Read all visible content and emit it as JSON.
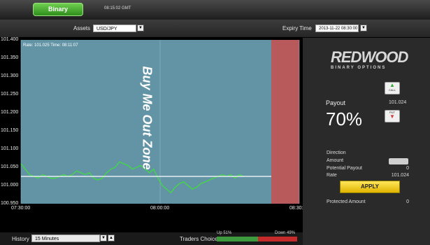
{
  "topbar": {
    "binary_label": "Binary",
    "time": "08:15:02 GMT"
  },
  "options": {
    "assets_label": "Assets",
    "asset_value": "USD/JPY",
    "expiry_label": "Expiry Time",
    "expiry_value": "2013-11-22 08:30:00"
  },
  "chart": {
    "rate_info": "Rate: 101.025 Time: 08:11:07",
    "zone_text": "Buy Me Out Zone",
    "y_ticks": [
      "101.400",
      "101.350",
      "101.300",
      "101.250",
      "101.200",
      "101.150",
      "101.100",
      "101.050",
      "101.000",
      "100.950"
    ],
    "x_ticks": [
      "07:30:00",
      "08:00:00",
      "08:30:00"
    ]
  },
  "chart_data": {
    "type": "line",
    "ylim": [
      100.95,
      101.4
    ],
    "x_range": [
      "07:30:00",
      "08:30:00"
    ],
    "current_rate": 101.025,
    "series": [
      {
        "values": [
          101.06,
          101.045,
          101.03,
          101.025,
          101.02,
          101.03,
          101.025,
          101.02,
          101.02,
          101.025,
          101.03,
          101.025,
          101.03,
          101.04,
          101.035,
          101.03,
          101.035,
          101.02,
          101.015,
          101.02,
          101.035,
          101.045,
          101.05,
          101.065,
          101.06,
          101.055,
          101.045,
          101.05,
          101.055,
          101.045,
          101.035,
          101.045,
          101.02,
          101.0,
          100.99,
          100.98,
          100.995,
          101.005,
          101.01,
          101.0,
          100.99,
          100.995,
          101.005,
          101.01,
          101.015,
          101.02,
          101.025,
          101.03,
          101.025,
          101.03,
          101.02,
          101.03,
          101.025
        ]
      }
    ]
  },
  "history": {
    "label": "History",
    "value": "15 Minutes"
  },
  "traders": {
    "label": "Traders Choice",
    "up": "Up 51%",
    "down": "Down 49%",
    "up_fraction": 0.51
  },
  "side": {
    "logo_top": "REDWOOD",
    "logo_bottom": "BINARY OPTIONS",
    "call_label": "CALL",
    "put_label": "PUT",
    "payout_label": "Payout",
    "payout_rate": "101.024",
    "payout_value": "70%",
    "direction_label": "Direction",
    "amount_label": "Amount",
    "potential_label": "Potential Payout",
    "potential_value": "0",
    "rate_label": "Rate",
    "rate_value": "101.024",
    "apply_label": "APPLY",
    "protected_label": "Protected Amount",
    "protected_value": "0"
  }
}
